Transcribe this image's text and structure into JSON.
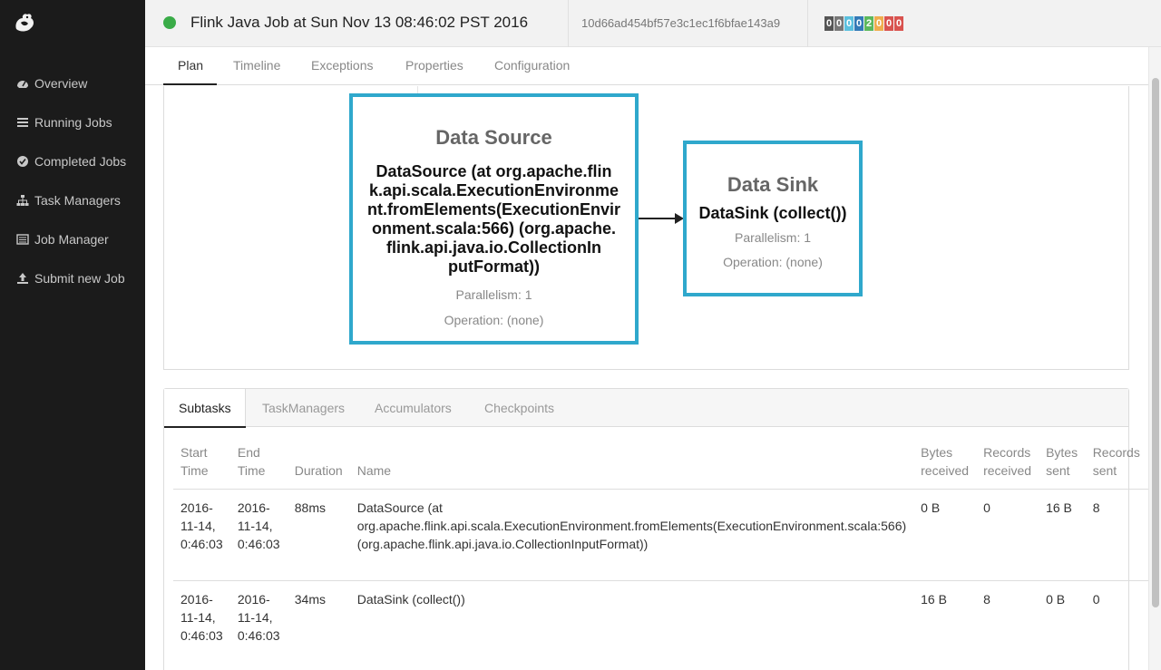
{
  "sidebar": {
    "logo_icon": "squirrel-logo",
    "items": [
      {
        "label": "Overview",
        "icon": "dashboard-icon"
      },
      {
        "label": "Running Jobs",
        "icon": "tasks-icon"
      },
      {
        "label": "Completed Jobs",
        "icon": "check-circle-icon"
      },
      {
        "label": "Task Managers",
        "icon": "sitemap-icon"
      },
      {
        "label": "Job Manager",
        "icon": "list-icon"
      },
      {
        "label": "Submit new Job",
        "icon": "upload-icon"
      }
    ]
  },
  "header": {
    "status_color": "#3aac48",
    "title": "Flink Java Job at Sun Nov 13 08:46:02 PST 2016",
    "job_id": "10d66ad454bf57e3c1ec1f6bfae143a9",
    "badges": [
      {
        "value": "0",
        "color": "#555555"
      },
      {
        "value": "0",
        "color": "#777777"
      },
      {
        "value": "0",
        "color": "#5bc0de"
      },
      {
        "value": "0",
        "color": "#337ab7"
      },
      {
        "value": "2",
        "color": "#5cb85c"
      },
      {
        "value": "0",
        "color": "#f0ad4e"
      },
      {
        "value": "0",
        "color": "#d9534f"
      },
      {
        "value": "0",
        "color": "#d9534f"
      }
    ]
  },
  "tabs": [
    "Plan",
    "Timeline",
    "Exceptions",
    "Properties",
    "Configuration"
  ],
  "plan": {
    "source": {
      "title": "Data Source",
      "desc_lines": [
        "DataSource (at org.apache.flin",
        "k.api.scala.ExecutionEnvironme",
        "nt.fromElements(ExecutionEnvir",
        "onment.scala:566) (org.apache.",
        "flink.api.java.io.CollectionIn",
        "putFormat))"
      ],
      "parallelism": "Parallelism: 1",
      "operation": "Operation: (none)"
    },
    "sink": {
      "title": "Data Sink",
      "desc": "DataSink (collect())",
      "parallelism": "Parallelism: 1",
      "operation": "Operation: (none)"
    },
    "node_border_color": "#2fa8cc"
  },
  "panel": {
    "tabs": [
      "Subtasks",
      "TaskManagers",
      "Accumulators",
      "Checkpoints"
    ],
    "columns": [
      [
        "Start",
        "Time"
      ],
      [
        "End",
        "Time"
      ],
      [
        "",
        "Duration"
      ],
      [
        "",
        "Name"
      ],
      [
        "Bytes",
        "received"
      ],
      [
        "Records",
        "received"
      ],
      [
        "Bytes",
        "sent"
      ],
      [
        "Records",
        "sent"
      ]
    ],
    "rows": [
      {
        "start": [
          "2016-",
          "11-14,",
          "0:46:03"
        ],
        "end": [
          "2016-",
          "11-14,",
          "0:46:03"
        ],
        "duration": "88ms",
        "name": [
          "DataSource (at",
          "org.apache.flink.api.scala.ExecutionEnvironment.fromElements(ExecutionEnvironment.scala:566)",
          "(org.apache.flink.api.java.io.CollectionInputFormat))"
        ],
        "bytes_received": "0 B",
        "records_received": "0",
        "bytes_sent": "16 B",
        "records_sent": "8"
      },
      {
        "start": [
          "2016-",
          "11-14,",
          "0:46:03"
        ],
        "end": [
          "2016-",
          "11-14,",
          "0:46:03"
        ],
        "duration": "34ms",
        "name": [
          "DataSink (collect())"
        ],
        "bytes_received": "16 B",
        "records_received": "8",
        "bytes_sent": "0 B",
        "records_sent": "0"
      }
    ]
  }
}
